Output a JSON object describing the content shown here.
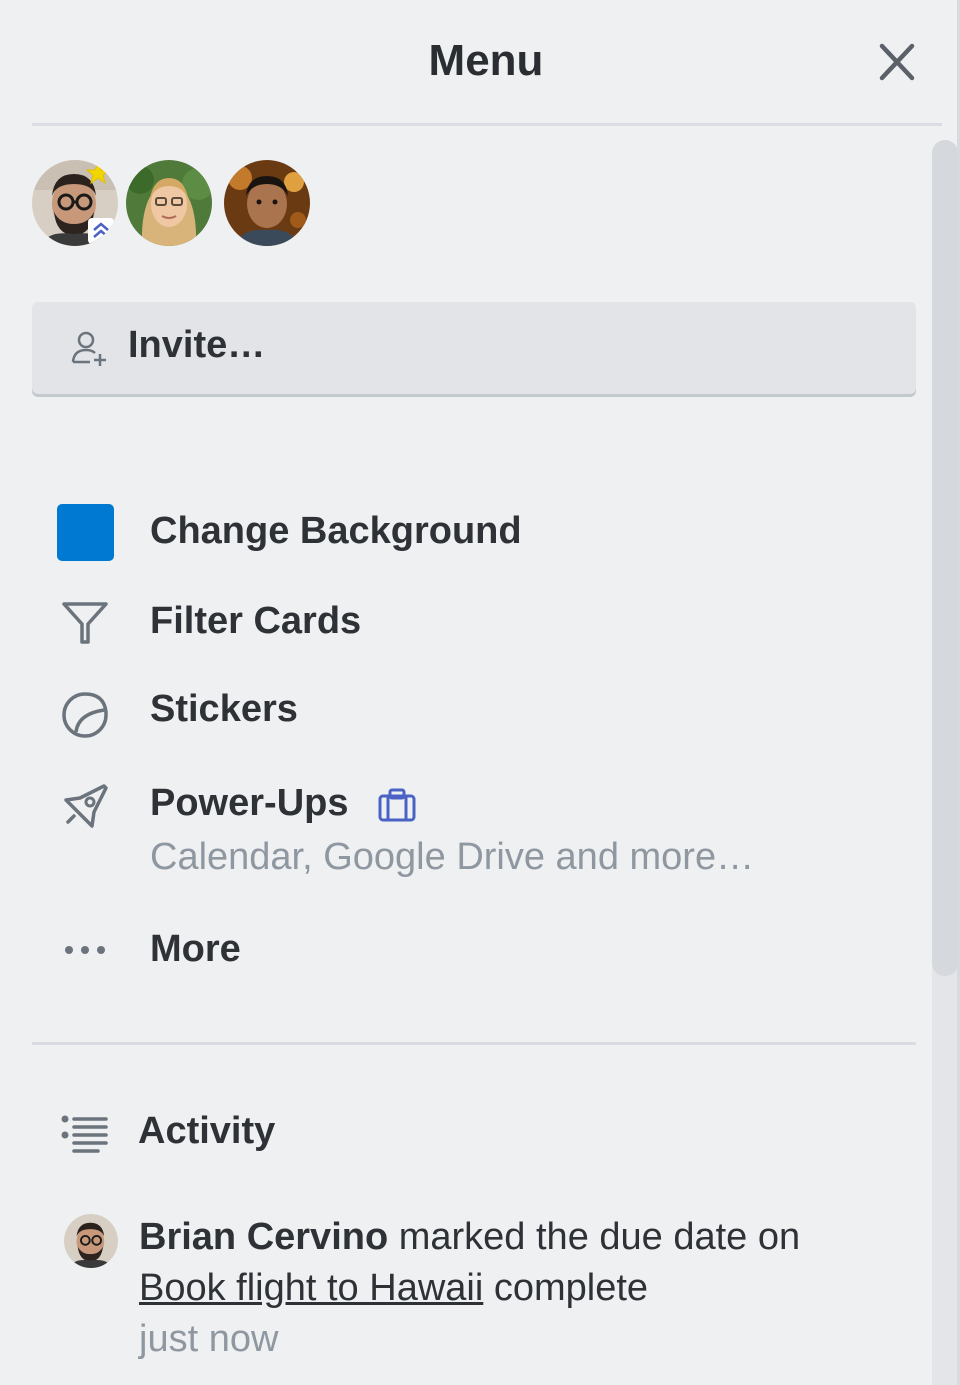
{
  "header": {
    "title": "Menu",
    "close_icon": "close-icon"
  },
  "members": [
    {
      "name_icon": "avatar-bearded-man-glasses",
      "badges": [
        "star-badge",
        "chevrons-up-badge"
      ]
    },
    {
      "name_icon": "avatar-woman-glasses"
    },
    {
      "name_icon": "avatar-man"
    }
  ],
  "invite": {
    "label": "Invite…",
    "icon": "add-person-icon"
  },
  "menu": {
    "change_background": {
      "label": "Change Background",
      "swatch_color": "#0079d3"
    },
    "filter_cards": {
      "label": "Filter Cards",
      "icon": "filter-icon"
    },
    "stickers": {
      "label": "Stickers",
      "icon": "sticker-icon"
    },
    "power_ups": {
      "label": "Power-Ups",
      "icon": "rocket-icon",
      "badge_icon": "briefcase-icon",
      "subtitle": "Calendar, Google Drive and more…"
    },
    "more": {
      "label": "More",
      "icon": "ellipsis-icon"
    }
  },
  "activity": {
    "title": "Activity",
    "icon": "activity-list-icon",
    "entries": [
      {
        "member": "Brian Cervino",
        "action": " marked the due date on ",
        "card": "Book flight to Hawaii",
        "suffix": " complete",
        "time": "just now"
      }
    ]
  },
  "colors": {
    "accent": "#0079d3",
    "badge_blue": "#4a62c4",
    "muted_text": "#8f98a1",
    "background": "#eff0f2"
  }
}
